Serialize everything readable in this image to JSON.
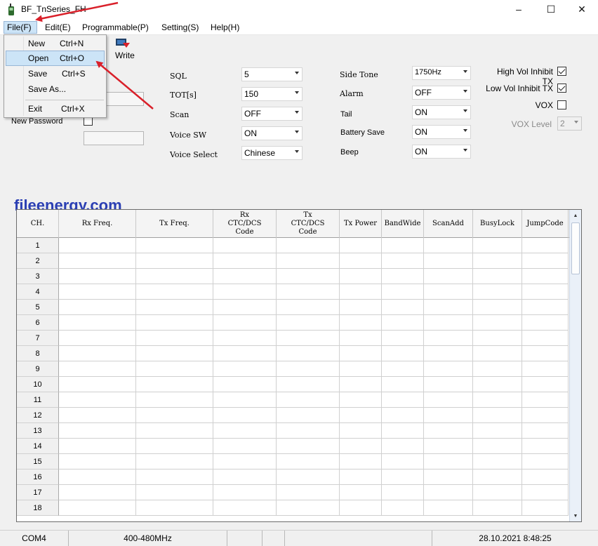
{
  "window": {
    "title": "BF_TnSeries_FH",
    "controls": {
      "minimize": "–",
      "maximize": "☐",
      "close": "✕"
    }
  },
  "menubar": {
    "file": "File(F)",
    "edit": "Edit(E)",
    "programmable": "Programmable(P)",
    "setting": "Setting(S)",
    "help": "Help(H)"
  },
  "file_menu": {
    "items": [
      {
        "label": "New",
        "shortcut": "Ctrl+N"
      },
      {
        "label": "Open",
        "shortcut": "Ctrl+O"
      },
      {
        "label": "Save",
        "shortcut": "Ctrl+S"
      },
      {
        "label": "Save As...",
        "shortcut": ""
      },
      {
        "label": "Exit",
        "shortcut": "Ctrl+X"
      }
    ]
  },
  "toolbar": {
    "write_label": "Write"
  },
  "password": {
    "new_password_label": "New Password",
    "new_password_checked": false
  },
  "settings": {
    "col1": [
      {
        "label": "SQL",
        "value": "5"
      },
      {
        "label": "TOT[s]",
        "value": "150"
      },
      {
        "label": "Scan",
        "value": "OFF"
      },
      {
        "label": "Voice SW",
        "value": "ON"
      },
      {
        "label": "Voice Select",
        "value": "Chinese"
      }
    ],
    "col2": [
      {
        "label": "Side Tone",
        "value": "1750Hz"
      },
      {
        "label": "Alarm",
        "value": "OFF"
      },
      {
        "label": "Tail",
        "value": "ON"
      },
      {
        "label": "Battery Save",
        "value": "ON"
      },
      {
        "label": "Beep",
        "value": "ON"
      }
    ],
    "checkboxes": [
      {
        "label": "High Vol Inhibit TX",
        "checked": true
      },
      {
        "label": "Low Vol Inhibit TX",
        "checked": true
      },
      {
        "label": "VOX",
        "checked": false
      }
    ],
    "vox_level": {
      "label": "VOX Level",
      "value": "2"
    }
  },
  "watermark": "fileenergy.com",
  "grid": {
    "columns": [
      "CH.",
      "Rx Freq.",
      "Tx Freq.",
      "Rx CTC/DCS Code",
      "Tx CTC/DCS Code",
      "Tx Power",
      "BandWide",
      "ScanAdd",
      "BusyLock",
      "JumpCode"
    ],
    "rows": [
      "1",
      "2",
      "3",
      "4",
      "5",
      "6",
      "7",
      "8",
      "9",
      "10",
      "11",
      "12",
      "13",
      "14",
      "15",
      "16",
      "17",
      "18"
    ]
  },
  "status": {
    "port": "COM4",
    "band": "400-480MHz",
    "datetime": "28.10.2021 8:48:25"
  },
  "colors": {
    "menu_highlight": "#cce4f7",
    "annotation_arrow": "#d9202a",
    "watermark": "#2b3fb3",
    "scrollbar": "#eaf0f8"
  }
}
